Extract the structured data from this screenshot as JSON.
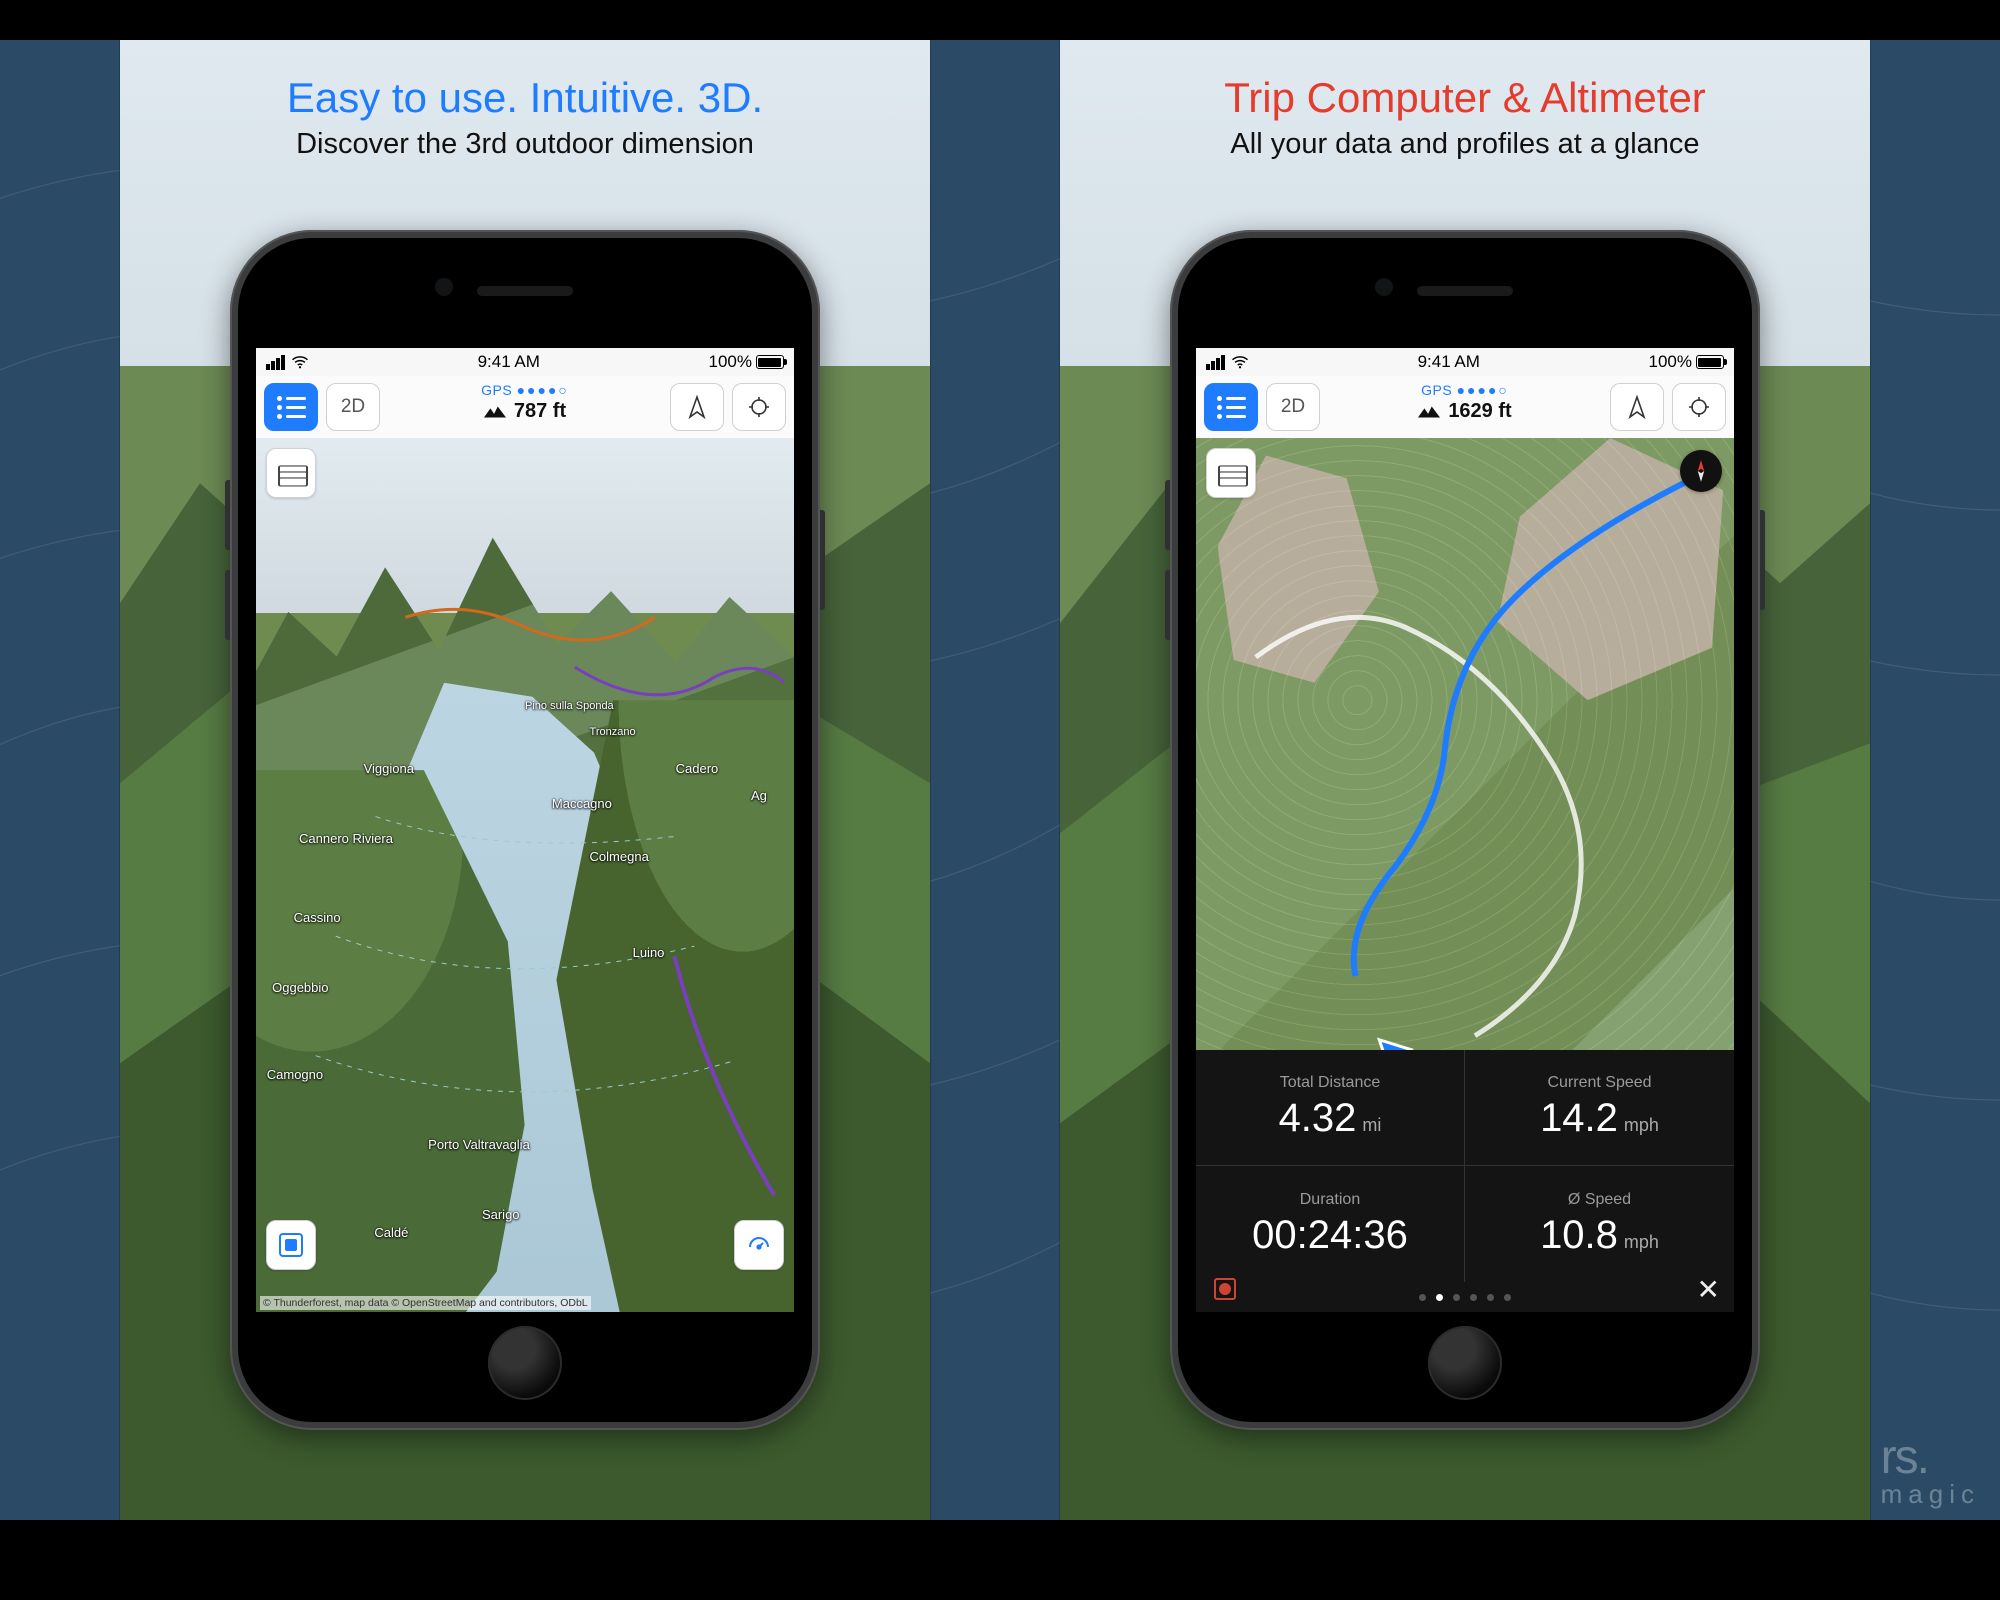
{
  "global": {
    "status_time": "9:41 AM",
    "battery": "100%"
  },
  "cardA": {
    "headline": "Easy to use. Intuitive. 3D.",
    "subline": "Discover the 3rd outdoor dimension",
    "mode_btn": "2D",
    "gps_text": "GPS",
    "altitude": "787 ft",
    "attribution": "© Thunderforest, map data © OpenStreetMap and contributors, ODbL",
    "labels": {
      "viggiona": "Viggiona",
      "cannero": "Cannero Riviera",
      "cassino": "Cassino",
      "oggebbio": "Oggebbio",
      "camogno": "Camogno",
      "colmegna": "Colmegna",
      "maccagno": "Maccagno",
      "cadero": "Cadero",
      "luino": "Luino",
      "portov": "Porto Valtravaglia",
      "calde": "Caldé",
      "sarigo": "Sarigo",
      "ag": "Ag",
      "pino": "Pino sulla Sponda",
      "tronzano": "Tronzano"
    }
  },
  "cardB": {
    "headline": "Trip Computer & Altimeter",
    "subline": "All your data and profiles at a glance",
    "mode_btn": "2D",
    "gps_text": "GPS",
    "altitude": "1629 ft",
    "trip": {
      "td_lab": "Total Distance",
      "td_val": "4.32",
      "td_unit": "mi",
      "cs_lab": "Current Speed",
      "cs_val": "14.2",
      "cs_unit": "mph",
      "du_lab": "Duration",
      "du_val": "00:24:36",
      "as_lab": "Ø Speed",
      "as_val": "10.8",
      "as_unit": "mph",
      "close": "✕"
    }
  },
  "brand": {
    "line1": "rs",
    "dot": ".",
    "line2": "magic"
  }
}
